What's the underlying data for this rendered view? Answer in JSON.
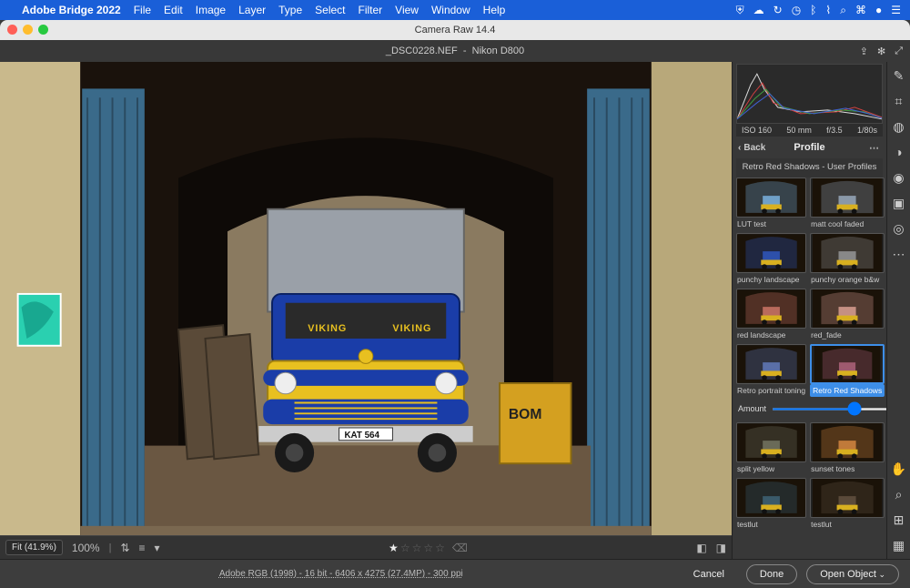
{
  "menubar": {
    "app": "Adobe Bridge 2022",
    "items": [
      "File",
      "Edit",
      "Image",
      "Layer",
      "Type",
      "Select",
      "Filter",
      "View",
      "Window",
      "Help"
    ]
  },
  "window": {
    "title": "Camera Raw 14.4",
    "filename": "_DSC0228.NEF",
    "camera": "Nikon D800"
  },
  "exif": {
    "iso": "ISO 160",
    "focal": "50 mm",
    "aperture": "f/3.5",
    "shutter": "1/80s"
  },
  "panel": {
    "back": "Back",
    "title": "Profile",
    "sub": "Retro Red Shadows - User Profiles"
  },
  "presets": [
    {
      "label": "LUT test",
      "tint": "#6fa0c8"
    },
    {
      "label": "matt cool faded",
      "tint": "#8a98a8"
    },
    {
      "label": "punchy landscape",
      "tint": "#2d50aa"
    },
    {
      "label": "punchy orange b&w",
      "tint": "#888888"
    },
    {
      "label": "red landscape",
      "tint": "#b96a5c"
    },
    {
      "label": "red_fade",
      "tint": "#c59083"
    },
    {
      "label": "Retro portrait toning",
      "tint": "#5a6fa8"
    },
    {
      "label": "Retro Red Shadows",
      "tint": "#9e5a6f",
      "selected": true
    },
    {
      "label": "split yellow",
      "tint": "#6a6a58"
    },
    {
      "label": "sunset tones",
      "tint": "#c07a3a"
    },
    {
      "label": "testlut",
      "tint": "#3a5a6a"
    },
    {
      "label": "testlut",
      "tint": "#5a4a3a"
    }
  ],
  "amount": {
    "label": "Amount",
    "value": "147"
  },
  "bottombar": {
    "fit": "Fit (41.9%)",
    "zoom": "100%",
    "rating": 1
  },
  "footer": {
    "meta": "Adobe RGB (1998) - 16 bit - 6406 x 4275 (27.4MP) - 300 ppi",
    "cancel": "Cancel",
    "done": "Done",
    "open": "Open Object"
  },
  "image_content": {
    "truck_brand": "VIKING",
    "license_plate": "KAT 564",
    "equipment_brand": "BOM"
  }
}
